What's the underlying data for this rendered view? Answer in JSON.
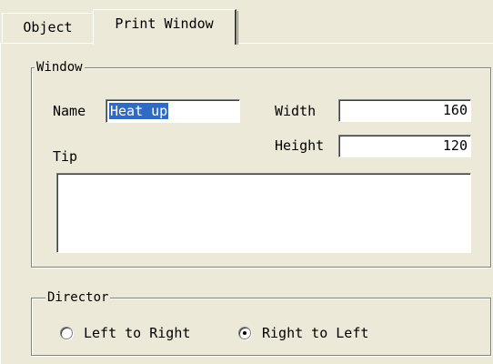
{
  "tabs": {
    "object_label": "Object",
    "print_window_label": "Print Window",
    "active": "Print Window"
  },
  "window_group": {
    "legend": "Window",
    "name_label": "Name",
    "name_value": "Heat up",
    "width_label": "Width",
    "width_value": "160",
    "height_label": "Height",
    "height_value": "120",
    "tip_label": "Tip",
    "tip_value": ""
  },
  "director_group": {
    "legend": "Director",
    "options": [
      {
        "label": "Left to Right",
        "checked": false
      },
      {
        "label": "Right to Left",
        "checked": true
      }
    ]
  },
  "colors": {
    "dialog_face": "#ece9d8",
    "selection": "#316ac5"
  }
}
